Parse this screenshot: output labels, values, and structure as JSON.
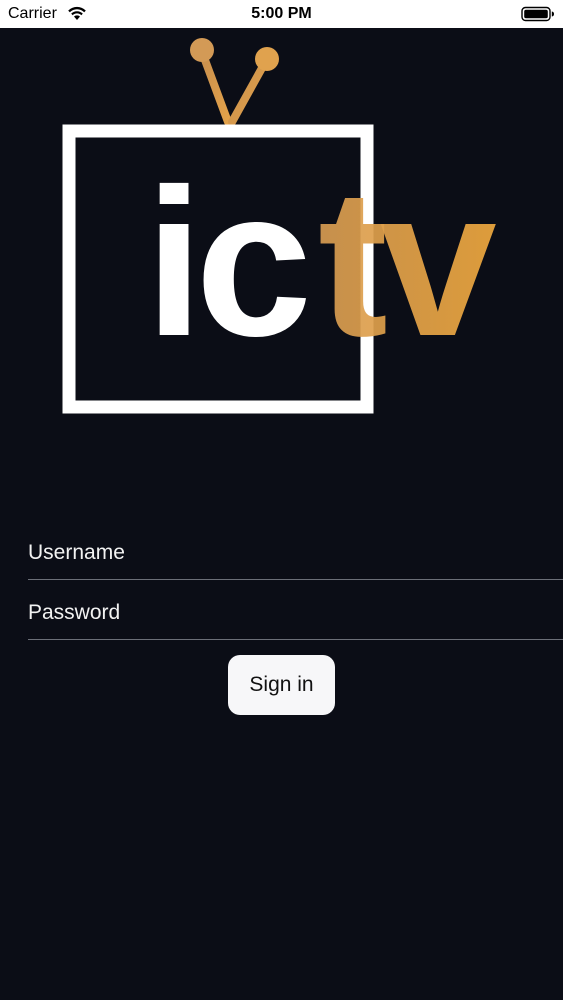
{
  "status_bar": {
    "carrier": "Carrier",
    "time": "5:00 PM",
    "wifi_icon": "wifi-icon",
    "battery_icon": "battery-icon"
  },
  "logo": {
    "text_white": "ic",
    "text_gold": "tv",
    "brand_white": "#ffffff",
    "brand_gold": "#e9a445"
  },
  "form": {
    "username_placeholder": "Username",
    "username_value": "",
    "password_placeholder": "Password",
    "password_value": "",
    "signin_label": "Sign in"
  },
  "colors": {
    "background": "#0b0d16",
    "divider": "#6c6f78",
    "button_bg": "#f7f7f9"
  }
}
